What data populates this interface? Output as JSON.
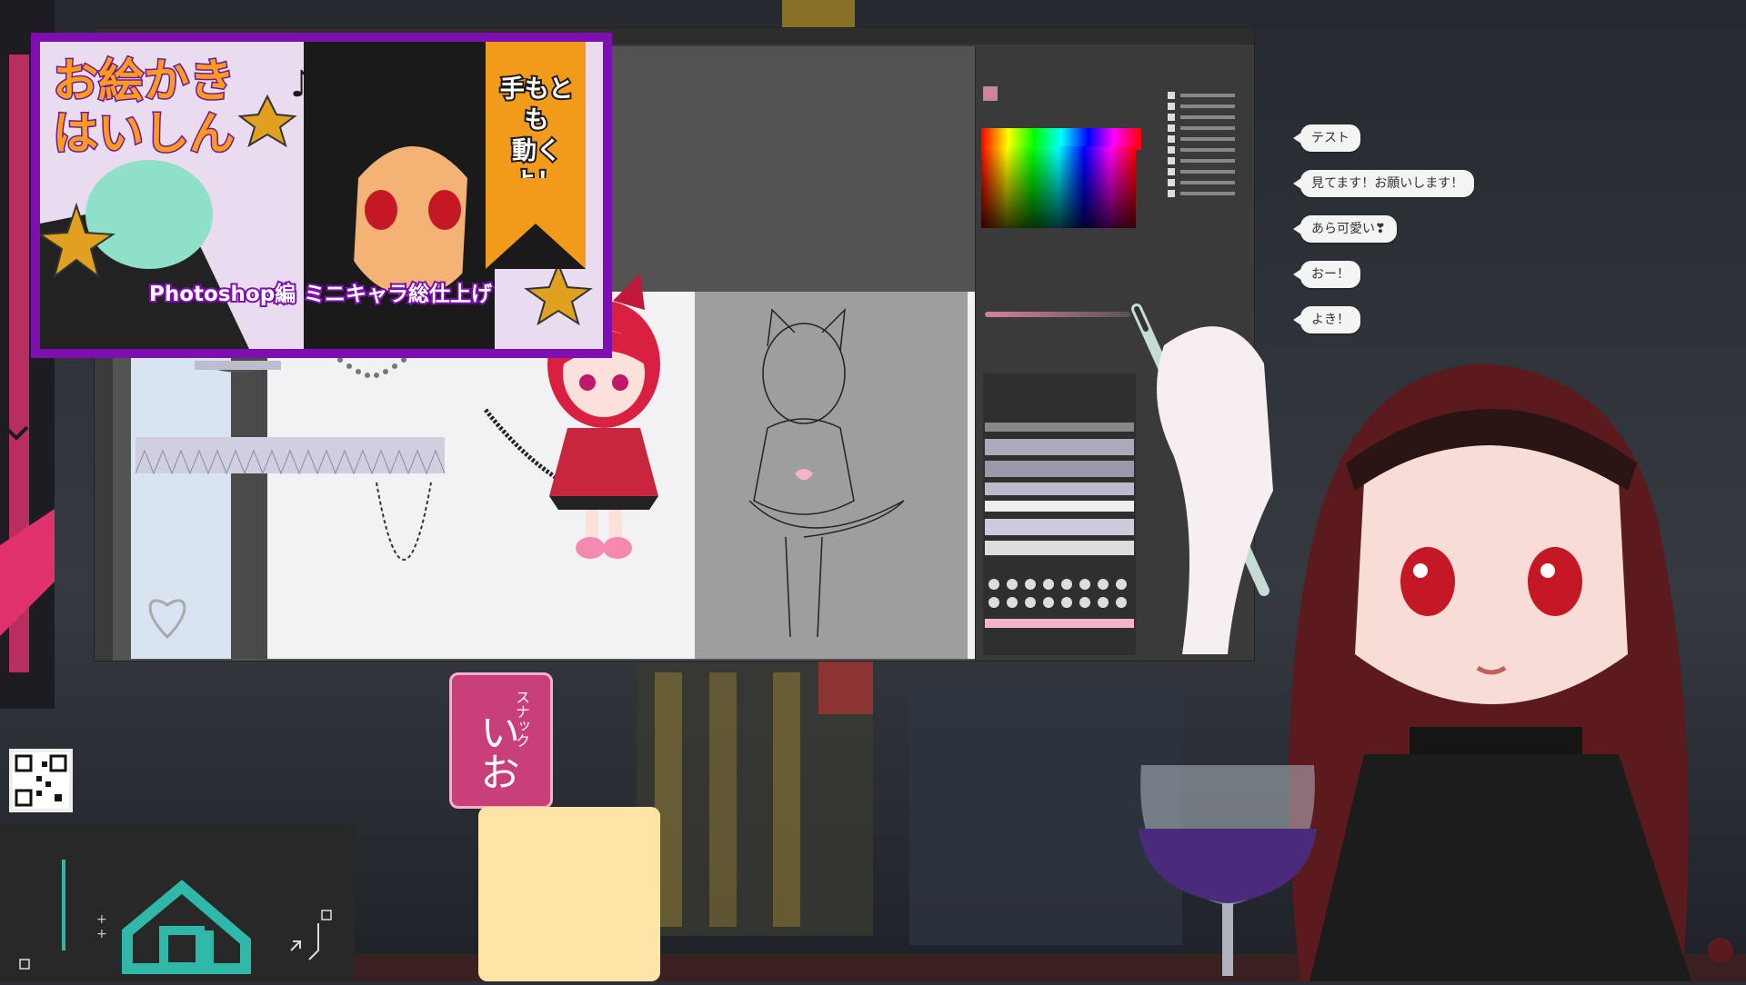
{
  "banner": {
    "title_line1": "お絵かき",
    "title_line2": "はいしん",
    "ribbon_line1": "手もとも",
    "ribbon_line2": "動くよ！",
    "tag1": "Photoshop編",
    "tag2": "ミニキャラ総仕上げ"
  },
  "chat": {
    "messages": [
      {
        "text": "テスト"
      },
      {
        "text": "見てます！お願いします！"
      },
      {
        "text": "あら可愛い❣"
      },
      {
        "text": "おー！"
      },
      {
        "text": "よき！"
      }
    ]
  },
  "sign": {
    "small": "スナック",
    "big": "いお"
  },
  "colors": {
    "banner_border": "#7d0fb0",
    "ribbon": "#f29a1a",
    "sign": "#c93f7a",
    "logo_teal": "#2fb8a8"
  }
}
